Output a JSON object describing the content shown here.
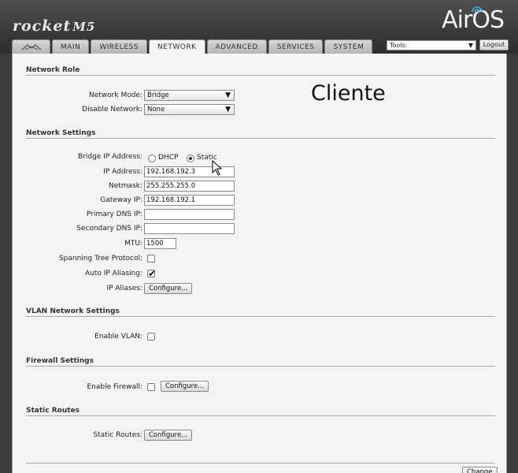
{
  "header": {
    "brand": "rocket",
    "model": "M5",
    "os_logo": "AirOS"
  },
  "tabs": [
    {
      "label": "",
      "icon": "ubiquiti-logo-icon"
    },
    {
      "label": "MAIN"
    },
    {
      "label": "WIRELESS"
    },
    {
      "label": "NETWORK"
    },
    {
      "label": "ADVANCED"
    },
    {
      "label": "SERVICES"
    },
    {
      "label": "SYSTEM"
    }
  ],
  "active_tab": "NETWORK",
  "tools": {
    "value": "Tools:"
  },
  "logout_label": "Logout",
  "annotation": "Cliente",
  "network_role": {
    "title": "Network Role",
    "mode_label": "Network Mode:",
    "mode_value": "Bridge",
    "disable_label": "Disable Network:",
    "disable_value": "None"
  },
  "network_settings": {
    "title": "Network Settings",
    "bridge_ip_label": "Bridge IP Address:",
    "dhcp_label": "DHCP",
    "static_label": "Static",
    "selected": "Static",
    "ip_label": "IP Address:",
    "ip_value": "192.168.192.3",
    "netmask_label": "Netmask:",
    "netmask_value": "255.255.255.0",
    "gateway_label": "Gateway IP:",
    "gateway_value": "192.168.192.1",
    "primary_dns_label": "Primary DNS IP:",
    "primary_dns_value": "",
    "secondary_dns_label": "Secondary DNS IP:",
    "secondary_dns_value": "",
    "mtu_label": "MTU:",
    "mtu_value": "1500",
    "stp_label": "Spanning Tree Protocol:",
    "stp_checked": false,
    "alias_label": "Auto IP Aliasing:",
    "alias_checked": true,
    "ip_aliases_label": "IP Aliases:",
    "configure_label": "Configure..."
  },
  "vlan": {
    "title": "VLAN Network Settings",
    "enable_label": "Enable VLAN:",
    "checked": false
  },
  "firewall": {
    "title": "Firewall Settings",
    "enable_label": "Enable Firewall:",
    "checked": false,
    "configure_label": "Configure..."
  },
  "static_routes": {
    "title": "Static Routes",
    "label": "Static Routes:",
    "configure_label": "Configure..."
  },
  "footer": {
    "change_label": "Change"
  },
  "colors": {
    "header_bg": "#3a3a3a",
    "content_bg": "#f4f4f4"
  }
}
